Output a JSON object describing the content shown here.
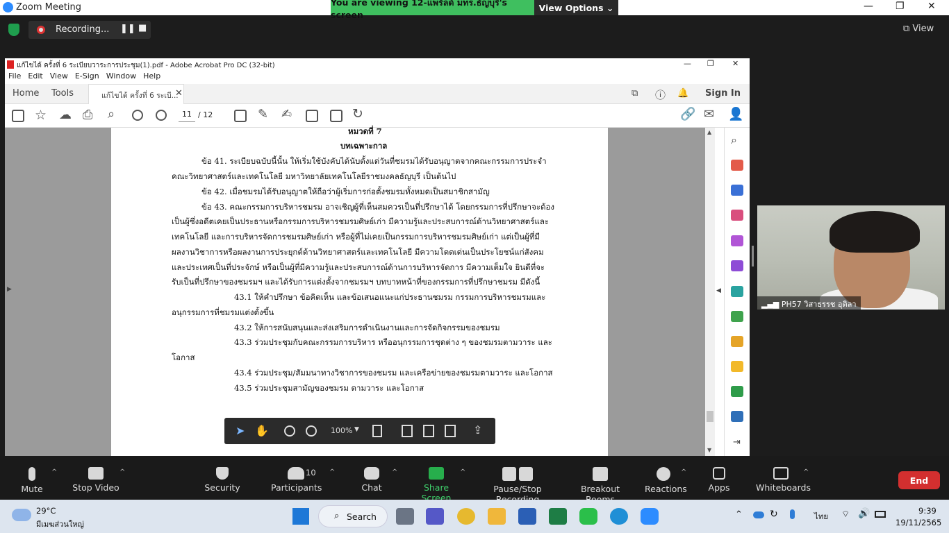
{
  "zoom": {
    "window_title": "Zoom Meeting",
    "viewing_banner": "You are viewing 12-แพรัลด์ มทร.ธัญบุรี's screen",
    "view_options": "View Options",
    "recording_label": "Recording...",
    "view_button": "View",
    "participant_name": "PH57 วิสาธรรช อุติลา",
    "bottom_bar": {
      "mute": "Mute",
      "stop_video": "Stop Video",
      "security": "Security",
      "participants": "Participants",
      "participants_count": "10",
      "chat": "Chat",
      "share_screen": "Share Screen",
      "pause_stop_recording": "Pause/Stop Recording",
      "breakout_rooms": "Breakout Rooms",
      "reactions": "Reactions",
      "apps": "Apps",
      "whiteboards": "Whiteboards",
      "end": "End"
    }
  },
  "acrobat": {
    "title": "แก้ไขได้ ครั้งที่ 6 ระเบียบวาระการประชุม(1).pdf - Adobe Acrobat Pro DC (32-bit)",
    "menu": [
      "File",
      "Edit",
      "View",
      "E-Sign",
      "Window",
      "Help"
    ],
    "tabs": {
      "home": "Home",
      "tools": "Tools",
      "doc": "แก้ไขได้ ครั้งที่ 6 ระเบี..."
    },
    "sign_in": "Sign In",
    "page_current": "11",
    "page_total": "/ 12",
    "zoom_level": "100%",
    "page_lines": [
      "หมวดที่ 7",
      "บทเฉพาะกาล",
      "ข้อ 41. ระเบียบฉบับนี้นั้น ให้เริ่มใช้บังคับได้นับตั้งแต่วันที่ชมรมได้รับอนุญาตจากคณะกรรมการประจำ",
      "คณะวิทยาศาสตร์และเทคโนโลยี มหาวิทยาลัยเทคโนโลยีราชมงคลธัญบุรี เป็นต้นไป",
      "ข้อ 42. เมื่อชมรมได้รับอนุญาตให้ถือว่าผู้เริ่มการก่อตั้งชมรมทั้งหมดเป็นสมาชิกสามัญ",
      "ข้อ 43. คณะกรรมการบริหารชมรม อาจเชิญผู้ที่เห็นสมควรเป็นที่ปรึกษาได้ โดยกรรมการที่ปรึกษาจะต้อง",
      "เป็นผู้ซึ่งอดีตเคยเป็นประธานหรือกรรมการบริหารชมรมศิษย์เก่า  มีความรู้และประสบการณ์ด้านวิทยาศาสตร์และ",
      "เทคโนโลยี  และการบริหารจัดการชมรมศิษย์เก่า  หรือผู้ที่ไม่เคยเป็นกรรมการบริหารชมรมศิษย์เก่า  แต่เป็นผู้ที่มี",
      "ผลงานวิชาการหรือผลงานการประยุกต์ด้านวิทยาศาสตร์และเทคโนโลยี       มีความโดดเด่นเป็นประโยชน์แก่สังคม",
      "และประเทศเป็นที่ประจักษ์  หรือเป็นผู้ที่มีความรู้และประสบการณ์ด้านการบริหารจัดการ  มีความเต็มใจ  ยินดีที่จะ",
      "รับเป็นที่ปรึกษาของชมรมฯ  และได้รับการแต่งตั้งจากชมรมฯ  บทบาทหน้าที่ของกรรมการที่ปรึกษาชมรม  มีดังนี้",
      "43.1  ให้คำปรึกษา  ข้อคิดเห็น  และข้อเสนอแนะแก่ประธานชมรม  กรรมการบริหารชมรมและ",
      "อนุกรรมการที่ชมรมแต่งตั้งขึ้น",
      "43.2 ให้การสนับสนุนและส่งเสริมการดำเนินงานและการจัดกิจกรรมของชมรม",
      "43.3 ร่วมประชุมกับคณะกรรมการบริหาร  หรืออนุกรรมการชุดต่าง ๆ ของชมรมตามวาระ  และ",
      "โอกาส",
      "43.4 ร่วมประชุม/สัมมนาทางวิชาการของชมรม และเครือข่ายของชมรมตามวาระ และโอกาส",
      "43.5 ร่วมประชุมสามัญของชมรม ตามวาระ และโอกาส"
    ]
  },
  "taskbar": {
    "weather_temp": "29°C",
    "weather_desc": "มีเมฆส่วนใหญ่",
    "search": "Search",
    "lang": "ไทย",
    "time": "9:39",
    "date": "19/11/2565"
  }
}
